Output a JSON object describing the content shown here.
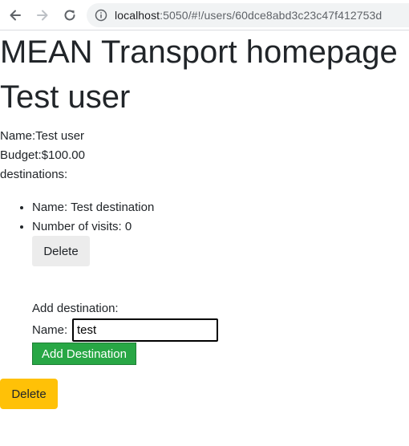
{
  "browser": {
    "url_host": "localhost",
    "url_path": ":5050/#!/users/60dce8abd3c23c47f412753d"
  },
  "page": {
    "heading": "MEAN Transport homepage",
    "user_heading": "Test user",
    "name_line": "Name:Test user",
    "budget_line": "Budget:$100.00",
    "destinations_label": "destinations:",
    "destinations": [
      {
        "name_line": "Name: Test destination",
        "visits_line": "Number of visits: 0",
        "delete_label": "Delete"
      }
    ],
    "add_destination": {
      "title": "Add destination:",
      "name_label": "Name:",
      "name_value": "test",
      "submit_label": "Add Destination"
    },
    "delete_user_label": "Delete"
  },
  "colors": {
    "success": "#28a745",
    "warning": "#ffc107",
    "light": "#ececec"
  }
}
